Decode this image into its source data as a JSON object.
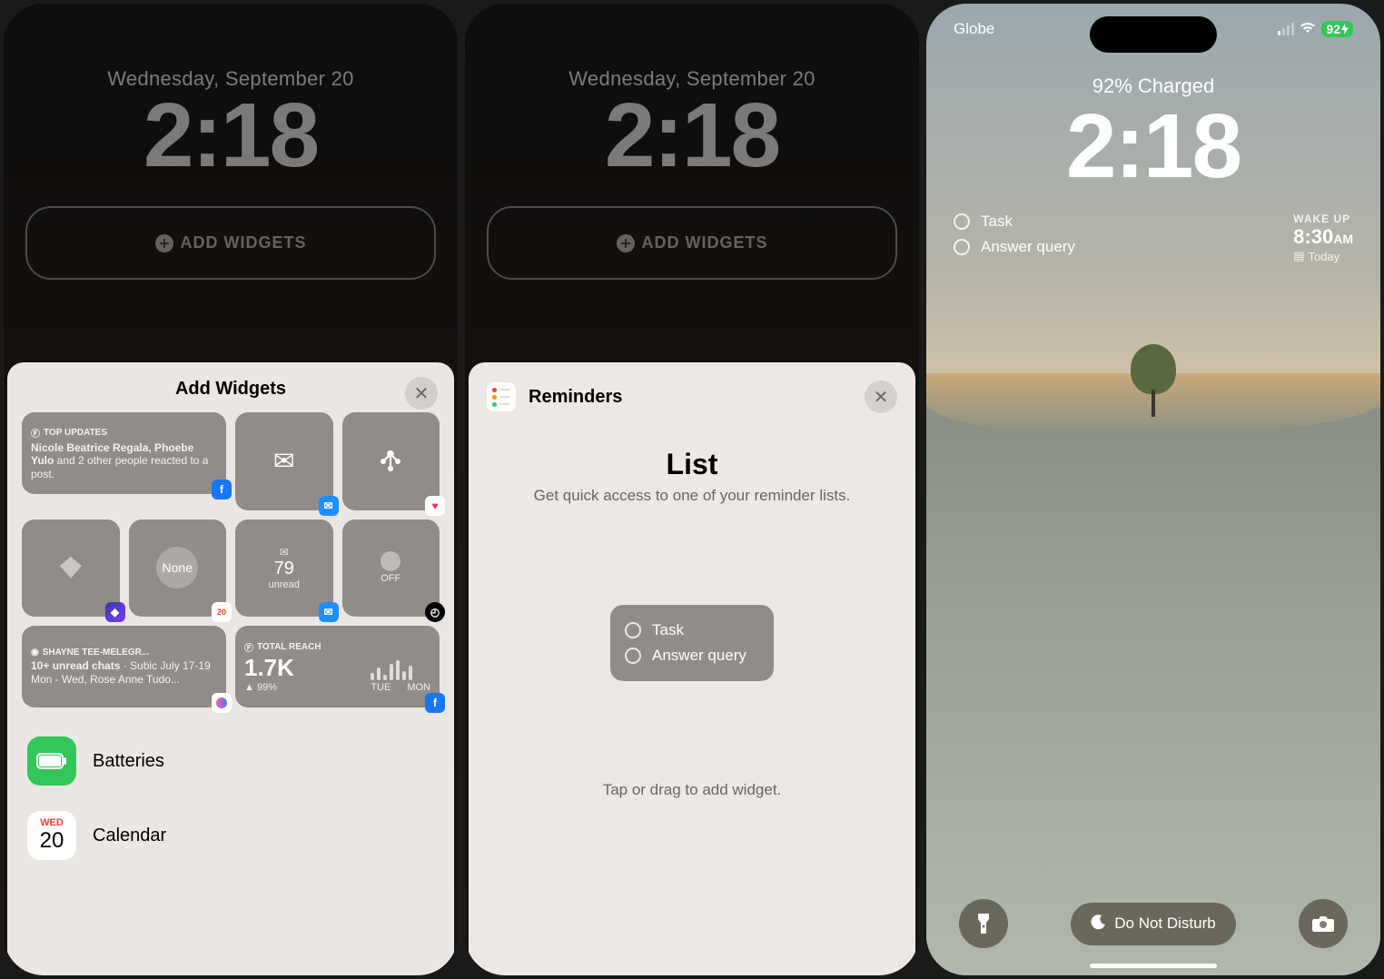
{
  "common": {
    "date": "Wednesday, September 20",
    "time": "2:18",
    "add_widgets_label": "ADD WIDGETS"
  },
  "sheet1": {
    "title": "Add Widgets",
    "tiles": {
      "top_updates": {
        "header": "TOP UPDATES",
        "bold": "Nicole Beatrice Regala, Phoebe Yulo",
        "rest": " and 2 other people reacted to a post."
      },
      "none": "None",
      "unread": {
        "count": "79",
        "label": "unread"
      },
      "clock": "OFF",
      "messenger": {
        "header": "SHAYNE TEE-MELEGR...",
        "bold": "10+ unread chats",
        "rest": " · Subic July 17-19 Mon - Wed, Rose Anne Tudo..."
      },
      "reach": {
        "header": "TOTAL REACH",
        "value": "1.7K",
        "pct": "99%",
        "d1": "TUE",
        "d2": "MON"
      }
    },
    "apps": {
      "batteries": "Batteries",
      "calendar": "Calendar",
      "cal_wed": "WED",
      "cal_day": "20"
    }
  },
  "sheet2": {
    "title": "Reminders",
    "heading": "List",
    "sub": "Get quick access to one of your reminder lists.",
    "items": [
      "Task",
      "Answer query"
    ],
    "hint": "Tap or drag to add widget."
  },
  "phone3": {
    "carrier": "Globe",
    "battery": "92",
    "charged": "92% Charged",
    "time": "2:18",
    "reminders": [
      "Task",
      "Answer query"
    ],
    "alarm": {
      "label": "WAKE UP",
      "time": "8:30",
      "ampm": "AM",
      "sub": "Today"
    },
    "focus": "Do Not Disturb"
  }
}
